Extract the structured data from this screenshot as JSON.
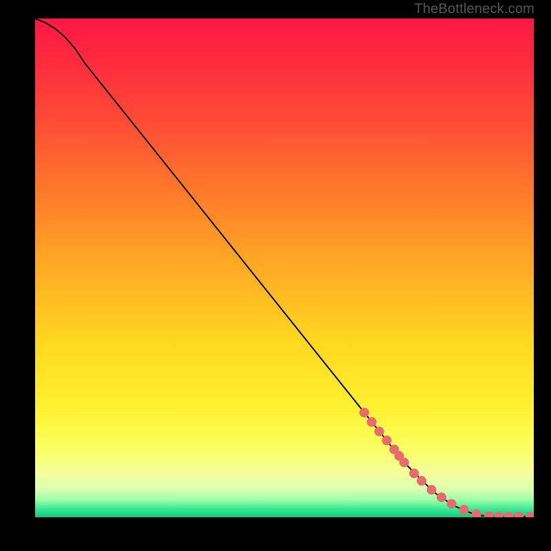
{
  "watermark": "TheBottleneck.com",
  "colors": {
    "curve": "#000000",
    "marker_fill": "#e86a6a",
    "marker_stroke": "#c94b4b",
    "frame": "#000000",
    "gradient_stops": [
      {
        "offset": 0.0,
        "color": "#ff1744"
      },
      {
        "offset": 0.08,
        "color": "#ff2a3f"
      },
      {
        "offset": 0.2,
        "color": "#ff4a36"
      },
      {
        "offset": 0.35,
        "color": "#ff7a2a"
      },
      {
        "offset": 0.5,
        "color": "#ffab24"
      },
      {
        "offset": 0.65,
        "color": "#ffd820"
      },
      {
        "offset": 0.78,
        "color": "#fff130"
      },
      {
        "offset": 0.86,
        "color": "#fbff60"
      },
      {
        "offset": 0.915,
        "color": "#f3ffa0"
      },
      {
        "offset": 0.945,
        "color": "#d8ffb0"
      },
      {
        "offset": 0.965,
        "color": "#9effa8"
      },
      {
        "offset": 0.985,
        "color": "#33e893"
      },
      {
        "offset": 1.0,
        "color": "#12c97a"
      }
    ]
  },
  "chart_data": {
    "type": "line",
    "title": "",
    "xlabel": "",
    "ylabel": "",
    "xlim": [
      0,
      100
    ],
    "ylim": [
      0,
      100
    ],
    "series": [
      {
        "name": "curve",
        "x": [
          0,
          2,
          4,
          6,
          8,
          10,
          14,
          20,
          30,
          40,
          50,
          60,
          68,
          74,
          80,
          84,
          87,
          89,
          90.5,
          92,
          94,
          97,
          100
        ],
        "y": [
          100,
          99.2,
          98.0,
          96.3,
          94.0,
          91.0,
          86.0,
          78.5,
          66.0,
          53.5,
          41.0,
          28.5,
          18.5,
          11.0,
          5.0,
          2.3,
          1.0,
          0.4,
          0.2,
          0.15,
          0.12,
          0.1,
          0.1
        ]
      }
    ],
    "markers": {
      "name": "highlighted-points",
      "x": [
        66,
        67.5,
        69,
        70.5,
        72,
        73,
        74,
        76,
        77.5,
        79.5,
        81.5,
        83.5,
        86,
        88.5,
        91,
        93,
        95,
        97,
        99.3
      ],
      "y": [
        21.0,
        19.1,
        17.2,
        15.4,
        13.6,
        12.3,
        11.0,
        8.8,
        7.3,
        5.5,
        4.0,
        2.7,
        1.5,
        0.6,
        0.2,
        0.16,
        0.14,
        0.12,
        0.1
      ]
    }
  }
}
